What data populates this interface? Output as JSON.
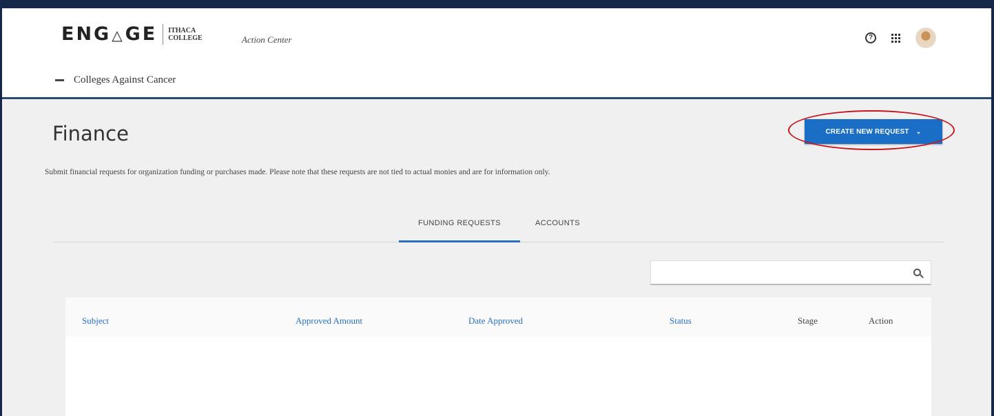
{
  "header": {
    "logo_text_left": "ENG",
    "logo_text_mid": "△",
    "logo_text_right": "GE",
    "logo_college": "ITHACA COLLEGE",
    "section": "Action Center",
    "help_icon": "help-circle-icon",
    "apps_icon": "grid-icon",
    "avatar_icon": "user-avatar",
    "org_name": "Colleges Against Cancer"
  },
  "page": {
    "title": "Finance",
    "create_button": "CREATE NEW REQUEST",
    "create_button_chevron": "⌄",
    "description": "Submit financial requests for organization funding or purchases made. Please note that these requests are not tied to actual monies and are for information only."
  },
  "tabs": [
    {
      "label": "FUNDING REQUESTS",
      "active": true
    },
    {
      "label": "ACCOUNTS",
      "active": false
    }
  ],
  "search": {
    "placeholder": "",
    "value": ""
  },
  "table": {
    "columns": [
      "Subject",
      "Approved Amount",
      "Date Approved",
      "Status",
      "Stage",
      "Action"
    ]
  },
  "colors": {
    "brand_blue": "#1a6ec6",
    "highlight_red": "#c4161c",
    "link_blue": "#2a6fbf"
  }
}
